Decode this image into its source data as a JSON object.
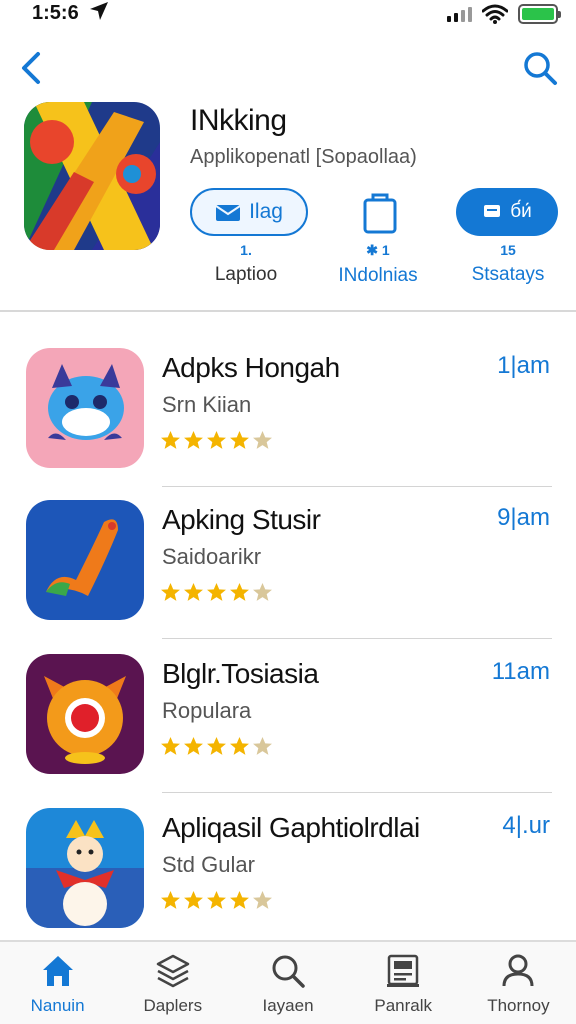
{
  "status_bar": {
    "time": "1:5:6",
    "battery_color": "#2bc34a"
  },
  "nav": {
    "back_icon": "chevron-left-icon",
    "search_icon": "search-icon",
    "accent": "#1478d4"
  },
  "app": {
    "title": "INkking",
    "subtitle": "Applikopenatl [Sopaollaa)",
    "pill_button_label": "Ilag",
    "get_button_label": "б́и́",
    "stats": [
      {
        "number": "1.",
        "label": "Laptioo"
      },
      {
        "number": "✱ 1",
        "label": "INdolnias"
      },
      {
        "number": "15",
        "label": "Stsatays"
      }
    ]
  },
  "list": [
    {
      "title": "Adpks Hongah",
      "subtitle": "Srn Kiian",
      "time": "1|am",
      "rating": 4.5
    },
    {
      "title": "Apking Stusir",
      "subtitle": "Saidoarikr",
      "time": "9|am",
      "rating": 4.5
    },
    {
      "title": "Blglr.Tosiasia",
      "subtitle": "Ropulara",
      "time": "11am",
      "rating": 4.5
    },
    {
      "title": "Apliqasil Gaphtiolrdlai",
      "subtitle": "Std Gular",
      "time": "4|.ur",
      "rating": 4.5
    }
  ],
  "tab_bar": {
    "active_color": "#1478d4",
    "tabs": [
      {
        "label": "Nanuin",
        "icon": "home-icon",
        "active": true
      },
      {
        "label": "Daplers",
        "icon": "layers-icon",
        "active": false
      },
      {
        "label": "Iayaen",
        "icon": "search-icon",
        "active": false
      },
      {
        "label": "Panralk",
        "icon": "document-icon",
        "active": false
      },
      {
        "label": "Thornoy",
        "icon": "person-icon",
        "active": false
      }
    ]
  }
}
